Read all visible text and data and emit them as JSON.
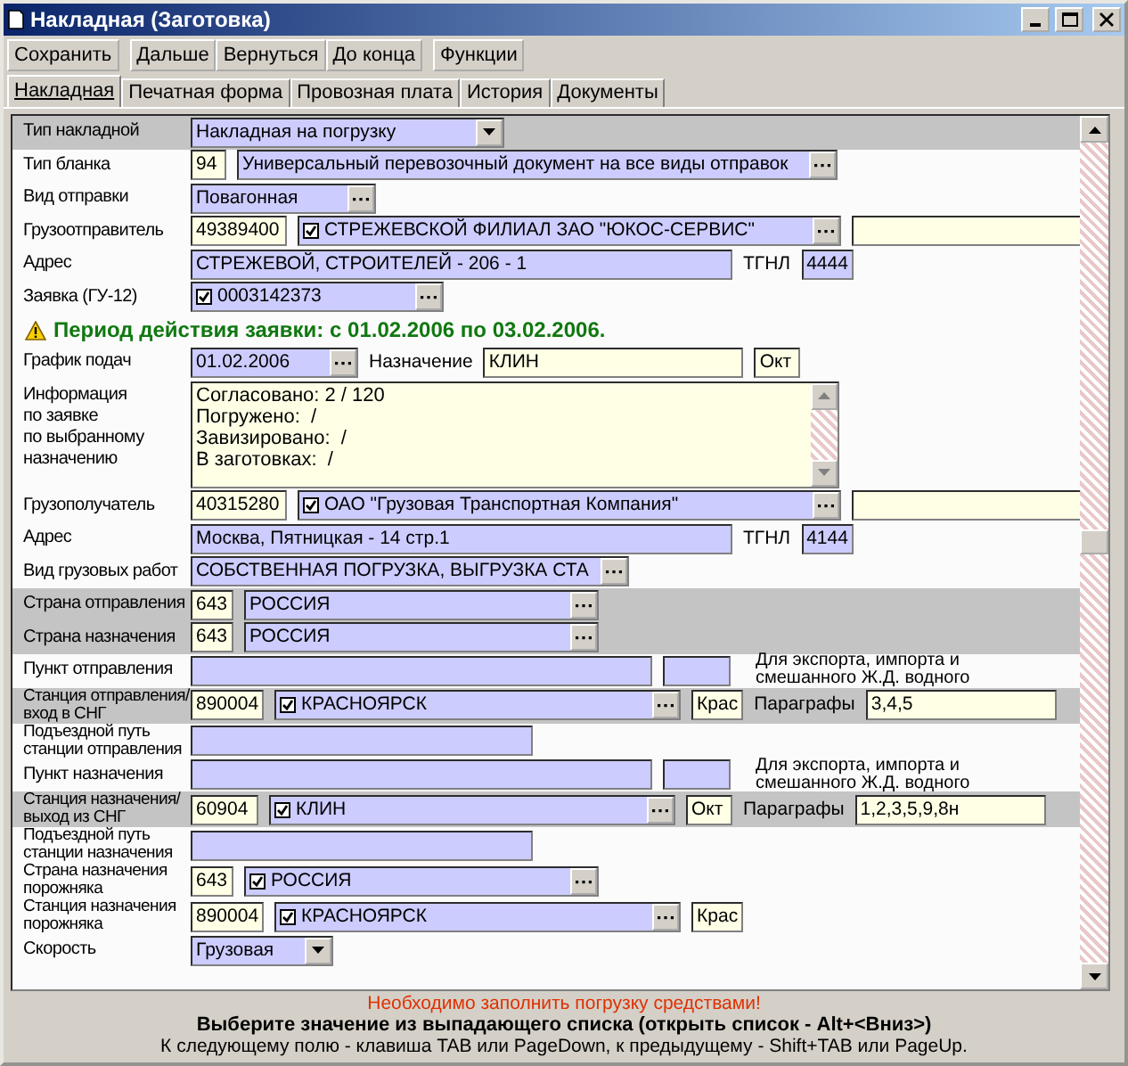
{
  "window": {
    "title": "Накладная (Заготовка)"
  },
  "toolbar": [
    {
      "label": "Сохранить"
    },
    {
      "label": "Дальше"
    },
    {
      "label": "Вернуться"
    },
    {
      "label": "До конца"
    },
    {
      "label": "Функции"
    }
  ],
  "tabs": [
    {
      "label": "Накладная",
      "selected": true
    },
    {
      "label": "Печатная форма",
      "selected": false
    },
    {
      "label": "Провозная плата",
      "selected": false
    },
    {
      "label": "История",
      "selected": false
    },
    {
      "label": "Документы",
      "selected": false
    }
  ],
  "form": {
    "rows": [
      {
        "kind": "fields",
        "label": "Тип накладной",
        "shaded": true,
        "fields": [
          {
            "kind": "dropdown",
            "value": "Накладная на погрузку"
          }
        ]
      },
      {
        "kind": "fields",
        "label": "Тип бланка",
        "shaded": false,
        "fields": [
          {
            "kind": "entry",
            "value": "94"
          },
          {
            "kind": "lookup",
            "value": "Универсальный перевозочный документ на все виды отправок"
          }
        ]
      },
      {
        "kind": "fields",
        "label": "Вид отправки",
        "shaded": false,
        "fields": [
          {
            "kind": "lookup",
            "value": "Повагонная"
          }
        ]
      },
      {
        "kind": "fields",
        "label": "Грузоотправитель",
        "shaded": false,
        "fields": [
          {
            "kind": "entry",
            "value": "49389400"
          },
          {
            "kind": "lookup",
            "checked": true,
            "value": "СТРЕЖЕВСКОЙ ФИЛИАЛ ЗАО \"ЮКОС-СЕРВИС\""
          },
          {
            "kind": "entry"
          }
        ]
      },
      {
        "kind": "fields",
        "label": "Адрес",
        "shaded": false,
        "fields": [
          {
            "kind": "text",
            "value": "СТРЕЖЕВОЙ, СТРОИТЕЛЕЙ - 206 - 1"
          },
          {
            "kind": "label",
            "value": "ТГНЛ"
          },
          {
            "kind": "text",
            "value": "4444"
          }
        ]
      },
      {
        "kind": "fields",
        "label": "Заявка (ГУ-12)",
        "shaded": false,
        "fields": [
          {
            "kind": "lookup",
            "checked": true,
            "value": "0003142373"
          }
        ]
      },
      {
        "kind": "notice",
        "text": "Период действия заявки: с 01.02.2006 по 03.02.2006."
      },
      {
        "kind": "fields",
        "label": "График подач",
        "shaded": false,
        "fields": [
          {
            "kind": "lookup",
            "value": "01.02.2006"
          },
          {
            "kind": "label",
            "value": "Назначение"
          },
          {
            "kind": "entry",
            "value": "КЛИН"
          },
          {
            "kind": "entry",
            "value": "Окт"
          }
        ]
      },
      {
        "kind": "memo",
        "label": "Информация\nпо заявке\nпо выбранному\nназначению",
        "lines": [
          "Согласовано: 2 / 120",
          "Погружено:  /",
          "Завизировано:  /",
          "В заготовках:  /"
        ]
      },
      {
        "kind": "fields",
        "label": "Грузополучатель",
        "shaded": false,
        "fields": [
          {
            "kind": "entry",
            "value": "40315280"
          },
          {
            "kind": "lookup",
            "checked": true,
            "value": "ОАО \"Грузовая Транспортная Компания\""
          },
          {
            "kind": "entry"
          }
        ]
      },
      {
        "kind": "fields",
        "label": "Адрес",
        "shaded": false,
        "fields": [
          {
            "kind": "text",
            "value": "Москва, Пятницкая - 14 стр.1"
          },
          {
            "kind": "label",
            "value": "ТГНЛ"
          },
          {
            "kind": "text",
            "value": "4144"
          }
        ]
      },
      {
        "kind": "fields",
        "label": "Вид грузовых работ",
        "shaded": false,
        "fields": [
          {
            "kind": "lookup",
            "value": "СОБСТВЕННАЯ ПОГРУЗКА, ВЫГРУЗКА СТА"
          }
        ]
      },
      {
        "kind": "fields",
        "label": "Страна отправления",
        "shaded": true,
        "fields": [
          {
            "kind": "entry",
            "value": "643"
          },
          {
            "kind": "lookup",
            "value": "РОССИЯ"
          }
        ]
      },
      {
        "kind": "fields",
        "label": "Страна назначения",
        "shaded": true,
        "fields": [
          {
            "kind": "entry",
            "value": "643"
          },
          {
            "kind": "lookup",
            "value": "РОССИЯ"
          }
        ]
      },
      {
        "kind": "fields",
        "label": "Пункт отправления",
        "shaded": false,
        "fields": [
          {
            "kind": "text"
          },
          {
            "kind": "text"
          },
          {
            "kind": "note",
            "value": "Для экспорта, импорта и\nсмешанного Ж.Д. водного"
          }
        ]
      },
      {
        "kind": "fields",
        "label": "Станция отправления/\nвход в СНГ",
        "shaded": true,
        "fields": [
          {
            "kind": "entry",
            "value": "890004"
          },
          {
            "kind": "lookup",
            "checked": true,
            "value": "КРАСНОЯРСК"
          },
          {
            "kind": "entry",
            "value": "Крас"
          },
          {
            "kind": "label",
            "value": "Параграфы"
          },
          {
            "kind": "entry",
            "value": "3,4,5"
          }
        ]
      },
      {
        "kind": "fields",
        "label": "Подъездной путь\nстанции отправления",
        "shaded": false,
        "fields": [
          {
            "kind": "text"
          }
        ]
      },
      {
        "kind": "fields",
        "label": "Пункт назначения",
        "shaded": false,
        "fields": [
          {
            "kind": "text"
          },
          {
            "kind": "text"
          },
          {
            "kind": "note",
            "value": "Для экспорта, импорта и\nсмешанного Ж.Д. водного"
          }
        ]
      },
      {
        "kind": "fields",
        "label": "Станция назначения/\nвыход из СНГ",
        "shaded": true,
        "fields": [
          {
            "kind": "entry",
            "value": "60904"
          },
          {
            "kind": "lookup",
            "checked": true,
            "value": "КЛИН"
          },
          {
            "kind": "entry",
            "value": "Окт"
          },
          {
            "kind": "label",
            "value": "Параграфы"
          },
          {
            "kind": "entry",
            "value": "1,2,3,5,9,8н"
          }
        ]
      },
      {
        "kind": "fields",
        "label": "Подъездной путь\nстанции назначения",
        "shaded": false,
        "fields": [
          {
            "kind": "text"
          }
        ]
      },
      {
        "kind": "fields",
        "label": "Страна назначения\nпорожняка",
        "shaded": false,
        "fields": [
          {
            "kind": "entry",
            "value": "643"
          },
          {
            "kind": "lookup",
            "checked": true,
            "value": "РОССИЯ"
          }
        ]
      },
      {
        "kind": "fields",
        "label": "Станция назначения\nпорожняка",
        "shaded": false,
        "fields": [
          {
            "kind": "entry",
            "value": "890004"
          },
          {
            "kind": "lookup",
            "checked": true,
            "value": "КРАСНОЯРСК"
          },
          {
            "kind": "entry",
            "value": "Крас"
          }
        ]
      },
      {
        "kind": "fields",
        "label": "Скорость",
        "shaded": false,
        "fields": [
          {
            "kind": "dropdown",
            "value": "Грузовая"
          }
        ]
      }
    ]
  },
  "footer": {
    "error": "Необходимо заполнить погрузку средствами!",
    "hint": "Выберите значение из выпадающего списка (открыть список - Alt+<Вниз>)",
    "keys": "К следующему полю - клавиша TAB или PageDown, к предыдущему - Shift+TAB или PageUp."
  }
}
